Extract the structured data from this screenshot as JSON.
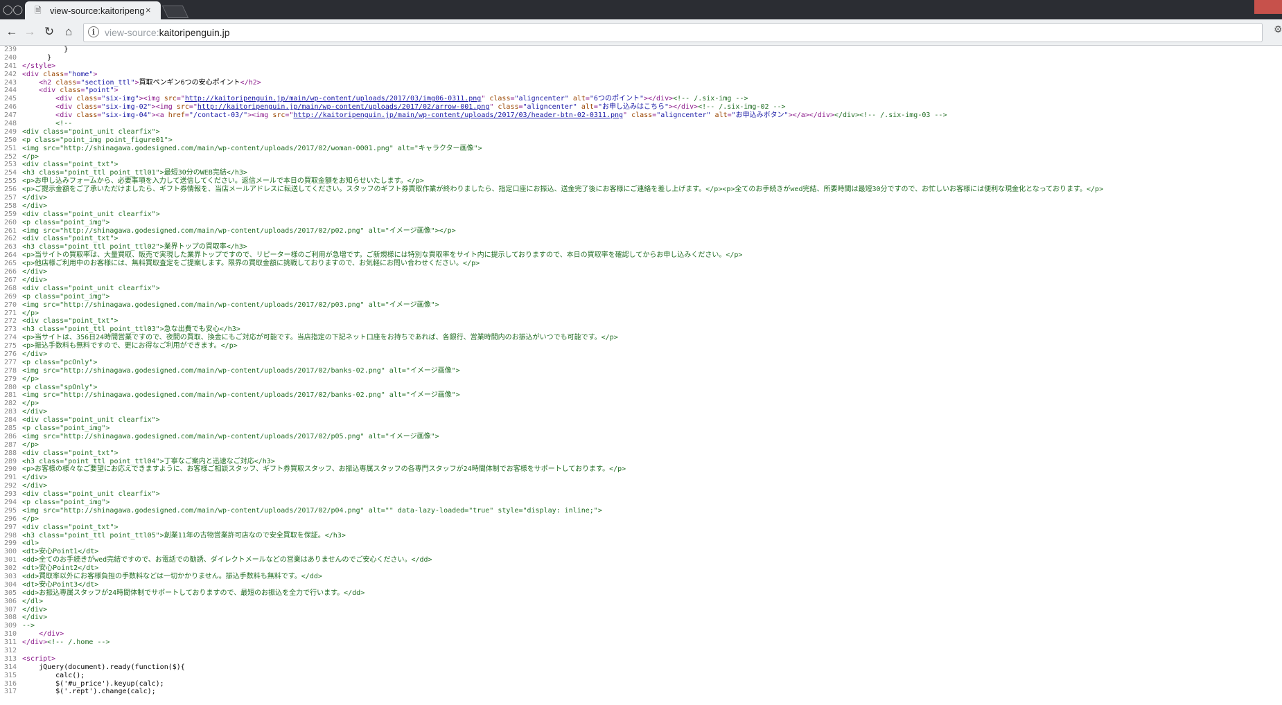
{
  "browser": {
    "tab_title": "view-source:kaitoripenguin.jp",
    "tab_close": "×",
    "address_prefix": "view-source:",
    "address_host": "kaitoripenguin.jp"
  },
  "source_lines": [
    {
      "n": "239",
      "t": [
        [
          "tx",
          "          }"
        ]
      ]
    },
    {
      "n": "240",
      "t": [
        [
          "tx",
          "      }"
        ]
      ]
    },
    {
      "n": "241",
      "t": [
        [
          "tg",
          "</style>"
        ]
      ]
    },
    {
      "n": "242",
      "t": [
        [
          "tg",
          "<div "
        ],
        [
          "at",
          "class"
        ],
        [
          "tg",
          "="
        ],
        [
          "vl",
          "\"home\""
        ],
        [
          "tg",
          ">"
        ]
      ]
    },
    {
      "n": "243",
      "t": [
        [
          "tx",
          "    "
        ],
        [
          "tg",
          "<h2 "
        ],
        [
          "at",
          "class"
        ],
        [
          "tg",
          "="
        ],
        [
          "vl",
          "\"section_ttl\""
        ],
        [
          "tg",
          ">"
        ],
        [
          "tx",
          "買取ペンギン6つの安心ポイント"
        ],
        [
          "tg",
          "</h2>"
        ]
      ]
    },
    {
      "n": "244",
      "t": [
        [
          "tx",
          "    "
        ],
        [
          "tg",
          "<div "
        ],
        [
          "at",
          "class"
        ],
        [
          "tg",
          "="
        ],
        [
          "vl",
          "\"point\""
        ],
        [
          "tg",
          ">"
        ]
      ]
    },
    {
      "n": "245",
      "t": [
        [
          "tx",
          "        "
        ],
        [
          "tg",
          "<div "
        ],
        [
          "at",
          "class"
        ],
        [
          "tg",
          "="
        ],
        [
          "vl",
          "\"six-img\""
        ],
        [
          "tg",
          "><img "
        ],
        [
          "at",
          "src"
        ],
        [
          "tg",
          "=\""
        ],
        [
          "lk",
          "http://kaitoripenguin.jp/main/wp-content/uploads/2017/03/img06-0311.png"
        ],
        [
          "tg",
          "\" "
        ],
        [
          "at",
          "class"
        ],
        [
          "tg",
          "="
        ],
        [
          "vl",
          "\"aligncenter\""
        ],
        [
          "tg",
          " "
        ],
        [
          "at",
          "alt"
        ],
        [
          "tg",
          "="
        ],
        [
          "vl",
          "\"6つのポイント\""
        ],
        [
          "tg",
          "></div>"
        ],
        [
          "cm",
          "<!-- /.six-img -->"
        ]
      ]
    },
    {
      "n": "246",
      "t": [
        [
          "tx",
          "        "
        ],
        [
          "tg",
          "<div "
        ],
        [
          "at",
          "class"
        ],
        [
          "tg",
          "="
        ],
        [
          "vl",
          "\"six-img-02\""
        ],
        [
          "tg",
          "><img "
        ],
        [
          "at",
          "src"
        ],
        [
          "tg",
          "=\""
        ],
        [
          "lk",
          "http://kaitoripenguin.jp/main/wp-content/uploads/2017/02/arrow-001.png"
        ],
        [
          "tg",
          "\" "
        ],
        [
          "at",
          "class"
        ],
        [
          "tg",
          "="
        ],
        [
          "vl",
          "\"aligncenter\""
        ],
        [
          "tg",
          " "
        ],
        [
          "at",
          "alt"
        ],
        [
          "tg",
          "="
        ],
        [
          "vl",
          "\"お申し込みはこちら\""
        ],
        [
          "tg",
          "></div>"
        ],
        [
          "cm",
          "<!-- /.six-img-02 -->"
        ]
      ]
    },
    {
      "n": "247",
      "t": [
        [
          "tx",
          "        "
        ],
        [
          "tg",
          "<div "
        ],
        [
          "at",
          "class"
        ],
        [
          "tg",
          "="
        ],
        [
          "vl",
          "\"six-img-04\""
        ],
        [
          "tg",
          "><a "
        ],
        [
          "at",
          "href"
        ],
        [
          "tg",
          "="
        ],
        [
          "vl",
          "\"/contact-03/\""
        ],
        [
          "tg",
          "><img "
        ],
        [
          "at",
          "src"
        ],
        [
          "tg",
          "=\""
        ],
        [
          "lk",
          "http://kaitoripenguin.jp/main/wp-content/uploads/2017/03/header-btn-02-0311.png"
        ],
        [
          "tg",
          "\" "
        ],
        [
          "at",
          "class"
        ],
        [
          "tg",
          "="
        ],
        [
          "vl",
          "\"aligncenter\""
        ],
        [
          "tg",
          " "
        ],
        [
          "at",
          "alt"
        ],
        [
          "tg",
          "="
        ],
        [
          "vl",
          "\"お申込みボタン\""
        ],
        [
          "tg",
          "></a></div>"
        ],
        [
          "cm",
          "</div><!-- /.six-img-03 -->"
        ]
      ]
    },
    {
      "n": "248",
      "t": [
        [
          "cm",
          "        <!--"
        ]
      ]
    },
    {
      "n": "249",
      "t": [
        [
          "cm",
          "<div class=\"point_unit clearfix\">"
        ]
      ]
    },
    {
      "n": "250",
      "t": [
        [
          "cm",
          "<p class=\"point_img point_figure01\">"
        ]
      ]
    },
    {
      "n": "251",
      "t": [
        [
          "cm",
          "<img src=\"http://shinagawa.godesigned.com/main/wp-content/uploads/2017/02/woman-0001.png\" alt=\"キャラクター画像\">"
        ]
      ]
    },
    {
      "n": "252",
      "t": [
        [
          "cm",
          "</p>"
        ]
      ]
    },
    {
      "n": "253",
      "t": [
        [
          "cm",
          "<div class=\"point_txt\">"
        ]
      ]
    },
    {
      "n": "254",
      "t": [
        [
          "cm",
          "<h3 class=\"point_ttl point_ttl01\">最短30分のWEB完結</h3>"
        ]
      ]
    },
    {
      "n": "255",
      "t": [
        [
          "cm",
          "<p>お申し込みフォームから、必要事項を入力して送信してください。返信メールで本日の買取金額をお知らせいたします。</p>"
        ]
      ]
    },
    {
      "n": "256",
      "t": [
        [
          "cm",
          "<p>ご提示金額をご了承いただけましたら、ギフト券情報を、当店メールアドレスに転送してください。スタッフのギフト券買取作業が終わりましたら、指定口座にお振込、送金完了後にお客様にご連絡を差し上げます。</p><p>全てのお手続きがwed完結、所要時間は最短30分ですので、お忙しいお客様には便利な現金化となっております。</p>"
        ]
      ]
    },
    {
      "n": "257",
      "t": [
        [
          "cm",
          "</div>"
        ]
      ]
    },
    {
      "n": "258",
      "t": [
        [
          "cm",
          "</div>"
        ]
      ]
    },
    {
      "n": "259",
      "t": [
        [
          "cm",
          "<div class=\"point_unit clearfix\">"
        ]
      ]
    },
    {
      "n": "260",
      "t": [
        [
          "cm",
          "<p class=\"point_img\">"
        ]
      ]
    },
    {
      "n": "261",
      "t": [
        [
          "cm",
          "<img src=\"http://shinagawa.godesigned.com/main/wp-content/uploads/2017/02/p02.png\" alt=\"イメージ画像\"></p>"
        ]
      ]
    },
    {
      "n": "262",
      "t": [
        [
          "cm",
          "<div class=\"point_txt\">"
        ]
      ]
    },
    {
      "n": "263",
      "t": [
        [
          "cm",
          "<h3 class=\"point_ttl point_ttl02\">業界トップの買取率</h3>"
        ]
      ]
    },
    {
      "n": "264",
      "t": [
        [
          "cm",
          "<p>当サイトの買取率は、大量買取、販売で実現した業界トップですので、リピーター様のご利用が急増です。ご新規様には特別な買取率をサイト内に提示しておりますので、本日の買取率を確認してからお申し込みください。</p>"
        ]
      ]
    },
    {
      "n": "265",
      "t": [
        [
          "cm",
          "<p>他店様ご利用中のお客様には、無料買取査定をご提案します。限界の買取金額に挑戦しておりますので、お気軽にお問い合わせください。</p>"
        ]
      ]
    },
    {
      "n": "266",
      "t": [
        [
          "cm",
          "</div>"
        ]
      ]
    },
    {
      "n": "267",
      "t": [
        [
          "cm",
          "</div>"
        ]
      ]
    },
    {
      "n": "268",
      "t": [
        [
          "cm",
          "<div class=\"point_unit clearfix\">"
        ]
      ]
    },
    {
      "n": "269",
      "t": [
        [
          "cm",
          "<p class=\"point_img\">"
        ]
      ]
    },
    {
      "n": "270",
      "t": [
        [
          "cm",
          "<img src=\"http://shinagawa.godesigned.com/main/wp-content/uploads/2017/02/p03.png\" alt=\"イメージ画像\">"
        ]
      ]
    },
    {
      "n": "271",
      "t": [
        [
          "cm",
          "</p>"
        ]
      ]
    },
    {
      "n": "272",
      "t": [
        [
          "cm",
          "<div class=\"point_txt\">"
        ]
      ]
    },
    {
      "n": "273",
      "t": [
        [
          "cm",
          "<h3 class=\"point_ttl point_ttl03\">急な出費でも安心</h3>"
        ]
      ]
    },
    {
      "n": "274",
      "t": [
        [
          "cm",
          "<p>当サイトは、356日24時間営業ですので、夜間の買取、換金にもご対応が可能です。当店指定の下記ネット口座をお持ちであれば、各銀行、営業時間内のお振込がいつでも可能です。</p>"
        ]
      ]
    },
    {
      "n": "275",
      "t": [
        [
          "cm",
          "<p>振込手数料も無料ですので、更にお得なご利用ができます。</p>"
        ]
      ]
    },
    {
      "n": "276",
      "t": [
        [
          "cm",
          "</div>"
        ]
      ]
    },
    {
      "n": "277",
      "t": [
        [
          "cm",
          "<p class=\"pcOnly\">"
        ]
      ]
    },
    {
      "n": "278",
      "t": [
        [
          "cm",
          "<img src=\"http://shinagawa.godesigned.com/main/wp-content/uploads/2017/02/banks-02.png\" alt=\"イメージ画像\">"
        ]
      ]
    },
    {
      "n": "279",
      "t": [
        [
          "cm",
          "</p>"
        ]
      ]
    },
    {
      "n": "280",
      "t": [
        [
          "cm",
          "<p class=\"spOnly\">"
        ]
      ]
    },
    {
      "n": "281",
      "t": [
        [
          "cm",
          "<img src=\"http://shinagawa.godesigned.com/main/wp-content/uploads/2017/02/banks-02.png\" alt=\"イメージ画像\">"
        ]
      ]
    },
    {
      "n": "282",
      "t": [
        [
          "cm",
          "</p>"
        ]
      ]
    },
    {
      "n": "283",
      "t": [
        [
          "cm",
          "</div>"
        ]
      ]
    },
    {
      "n": "284",
      "t": [
        [
          "cm",
          "<div class=\"point_unit clearfix\">"
        ]
      ]
    },
    {
      "n": "285",
      "t": [
        [
          "cm",
          "<p class=\"point_img\">"
        ]
      ]
    },
    {
      "n": "286",
      "t": [
        [
          "cm",
          "<img src=\"http://shinagawa.godesigned.com/main/wp-content/uploads/2017/02/p05.png\" alt=\"イメージ画像\">"
        ]
      ]
    },
    {
      "n": "287",
      "t": [
        [
          "cm",
          "</p>"
        ]
      ]
    },
    {
      "n": "288",
      "t": [
        [
          "cm",
          "<div class=\"point_txt\">"
        ]
      ]
    },
    {
      "n": "289",
      "t": [
        [
          "cm",
          "<h3 class=\"point_ttl point_ttl04\">丁寧なご案内と迅速なご対応</h3>"
        ]
      ]
    },
    {
      "n": "290",
      "t": [
        [
          "cm",
          "<p>お客様の様々なご要望にお応えできますように、お客様ご相談スタッフ、ギフト券買取スタッフ、お振込専属スタッフの各専門スタッフが24時間体制でお客様をサポートしております。</p>"
        ]
      ]
    },
    {
      "n": "291",
      "t": [
        [
          "cm",
          "</div>"
        ]
      ]
    },
    {
      "n": "292",
      "t": [
        [
          "cm",
          "</div>"
        ]
      ]
    },
    {
      "n": "293",
      "t": [
        [
          "cm",
          "<div class=\"point_unit clearfix\">"
        ]
      ]
    },
    {
      "n": "294",
      "t": [
        [
          "cm",
          "<p class=\"point_img\">"
        ]
      ]
    },
    {
      "n": "295",
      "t": [
        [
          "cm",
          "<img src=\"http://shinagawa.godesigned.com/main/wp-content/uploads/2017/02/p04.png\" alt=\"\" data-lazy-loaded=\"true\" style=\"display: inline;\">"
        ]
      ]
    },
    {
      "n": "296",
      "t": [
        [
          "cm",
          "</p>"
        ]
      ]
    },
    {
      "n": "297",
      "t": [
        [
          "cm",
          "<div class=\"point_txt\">"
        ]
      ]
    },
    {
      "n": "298",
      "t": [
        [
          "cm",
          "<h3 class=\"point_ttl point_ttl05\">創業11年の古物営業許可店なので安全買取を保証。</h3>"
        ]
      ]
    },
    {
      "n": "299",
      "t": [
        [
          "cm",
          "<dl>"
        ]
      ]
    },
    {
      "n": "300",
      "t": [
        [
          "cm",
          "<dt>安心Point1</dt>"
        ]
      ]
    },
    {
      "n": "301",
      "t": [
        [
          "cm",
          "<dd>全てのお手続きがwed完結ですので、お電話での勧誘、ダイレクトメールなどの営業はありませんのでご安心ください。</dd>"
        ]
      ]
    },
    {
      "n": "302",
      "t": [
        [
          "cm",
          "<dt>安心Point2</dt>"
        ]
      ]
    },
    {
      "n": "303",
      "t": [
        [
          "cm",
          "<dd>買取率以外にお客様負担の手数料などは一切かかりません。振込手数料も無料です。</dd>"
        ]
      ]
    },
    {
      "n": "304",
      "t": [
        [
          "cm",
          "<dt>安心Point3</dt>"
        ]
      ]
    },
    {
      "n": "305",
      "t": [
        [
          "cm",
          "<dd>お振込専属スタッフが24時間体制でサポートしておりますので、最短のお振込を全力で行います。</dd>"
        ]
      ]
    },
    {
      "n": "306",
      "t": [
        [
          "cm",
          "</dl>"
        ]
      ]
    },
    {
      "n": "307",
      "t": [
        [
          "cm",
          "</div>"
        ]
      ]
    },
    {
      "n": "308",
      "t": [
        [
          "cm",
          "</div>"
        ]
      ]
    },
    {
      "n": "309",
      "t": [
        [
          "cm",
          "-->"
        ]
      ]
    },
    {
      "n": "310",
      "t": [
        [
          "tx",
          "    "
        ],
        [
          "tg",
          "</div>"
        ]
      ]
    },
    {
      "n": "311",
      "t": [
        [
          "tg",
          "</div>"
        ],
        [
          "cm",
          "<!-- /.home -->"
        ]
      ]
    },
    {
      "n": "312",
      "t": [
        [
          "tx",
          ""
        ]
      ]
    },
    {
      "n": "313",
      "t": [
        [
          "tg",
          "<script>"
        ]
      ]
    },
    {
      "n": "314",
      "t": [
        [
          "tx",
          "    jQuery(document).ready(function($){"
        ]
      ]
    },
    {
      "n": "315",
      "t": [
        [
          "tx",
          "        calc();"
        ]
      ]
    },
    {
      "n": "316",
      "t": [
        [
          "tx",
          "        $('#u_price').keyup(calc);"
        ]
      ]
    },
    {
      "n": "317",
      "t": [
        [
          "tx",
          "        $('.rept').change(calc);"
        ]
      ]
    }
  ]
}
